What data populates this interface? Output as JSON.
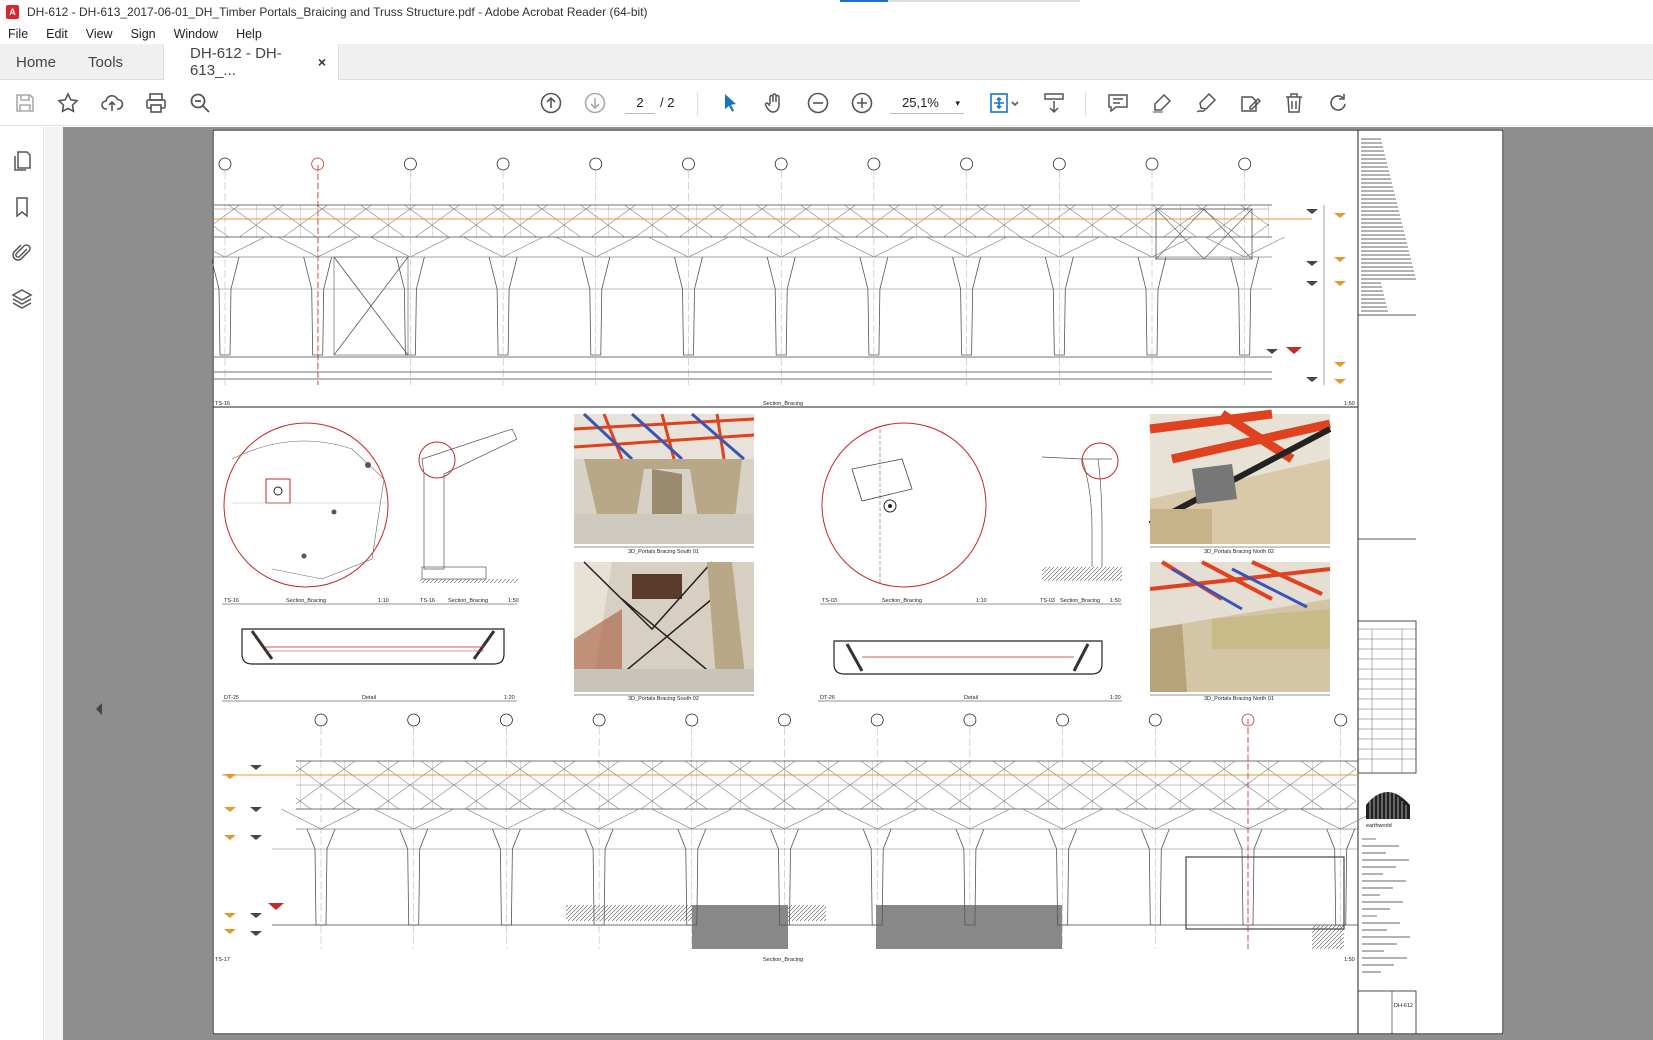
{
  "window": {
    "title": "DH-612 - DH-613_2017-06-01_DH_Timber Portals_Braicing and Truss Structure.pdf - Adobe Acrobat Reader (64-bit)"
  },
  "menu": [
    "File",
    "Edit",
    "View",
    "Sign",
    "Window",
    "Help"
  ],
  "tabs": {
    "home": "Home",
    "tools": "Tools",
    "document": "DH-612 - DH-613_...",
    "close_symbol": "×"
  },
  "toolbar": {
    "current_page": "2",
    "total_pages": "/ 2",
    "zoom": "25,1%",
    "zoom_caret": "▾"
  },
  "drawing": {
    "top_section": {
      "id": "TS-16",
      "title": "Section_Bracing",
      "scale": "1:50"
    },
    "bottom_section": {
      "id": "TS-17",
      "title": "Section_Bracing",
      "scale": "1:50"
    },
    "details": [
      {
        "id": "TS-16",
        "title": "Section_Bracing",
        "scale": "1:10"
      },
      {
        "id": "TS-16",
        "title": "Section_Bracing",
        "scale": "1:50"
      },
      {
        "id": "DT-25",
        "title": "Detail",
        "scale": "1:20"
      },
      {
        "id": "TS-03",
        "title": "Section_Bracing",
        "scale": "1:10"
      },
      {
        "id": "TS-03",
        "title": "Section_Bracing",
        "scale": "1:50"
      },
      {
        "id": "DT-26",
        "title": "Detail",
        "scale": "1:20"
      }
    ],
    "views_3d": [
      "3D_Portals Bracing South 01",
      "3D_Portals Bracing South 02",
      "3D_Portals Bracing North 02",
      "3D_Portals Bracing North 01"
    ],
    "titleblock_code": "DH-612",
    "logo_text": "earthworld"
  },
  "colors": {
    "accent_red": "#c62828",
    "steel_red": "#e0421f",
    "steel_blue": "#3a54b8",
    "timber": "#c8b48e",
    "level_orange": "#e8982a",
    "doc_background": "#8e8e8e"
  }
}
